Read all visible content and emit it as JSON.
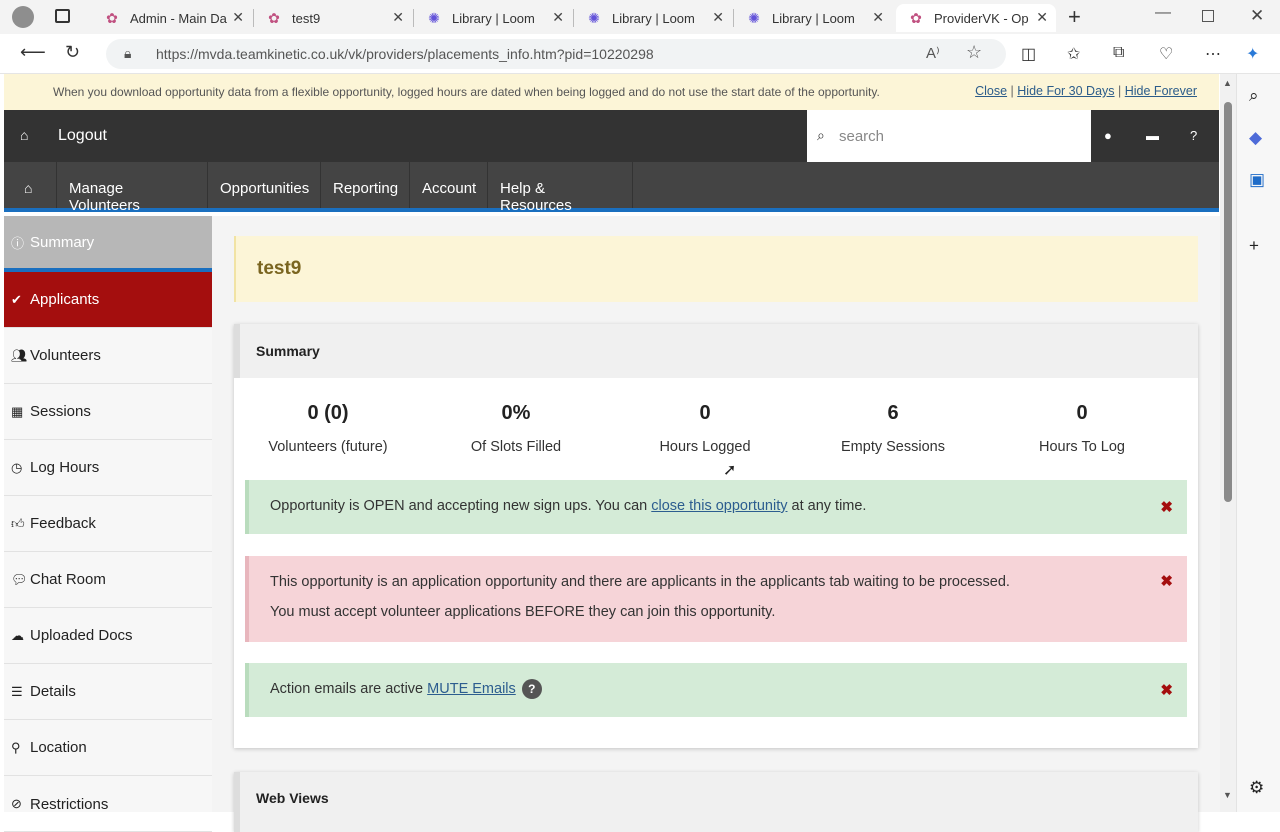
{
  "browser": {
    "tabs": [
      {
        "title": "Admin - Main Da",
        "icon": "app-icon"
      },
      {
        "title": "test9",
        "icon": "app-icon"
      },
      {
        "title": "Library | Loom",
        "icon": "loom-icon"
      },
      {
        "title": "Library | Loom",
        "icon": "loom-icon"
      },
      {
        "title": "Library | Loom",
        "icon": "loom-icon"
      },
      {
        "title": "ProviderVK - Op",
        "icon": "app-icon"
      }
    ],
    "url": "https://mvda.teamkinetic.co.uk/vk/providers/placements_info.htm?pid=10220298"
  },
  "notice": {
    "text": "When you download opportunity data from a flexible opportunity, logged hours are dated when being logged and do not use the start date of the opportunity.",
    "close": "Close",
    "hide30": "Hide For 30 Days",
    "hideforever": "Hide Forever"
  },
  "topbar": {
    "logout": "Logout",
    "search_placeholder": "search"
  },
  "nav": [
    "Manage Volunteers",
    "Opportunities",
    "Reporting",
    "Account",
    "Help & Resources"
  ],
  "sidebar": [
    {
      "label": "Summary",
      "icon": "info-icon"
    },
    {
      "label": "Applicants",
      "icon": "check-icon"
    },
    {
      "label": "Volunteers",
      "icon": "users-icon"
    },
    {
      "label": "Sessions",
      "icon": "calendar-icon"
    },
    {
      "label": "Log Hours",
      "icon": "clock-icon"
    },
    {
      "label": "Feedback",
      "icon": "thumbs-up-icon"
    },
    {
      "label": "Chat Room",
      "icon": "chat-icon"
    },
    {
      "label": "Uploaded Docs",
      "icon": "cloud-upload-icon"
    },
    {
      "label": "Details",
      "icon": "list-icon"
    },
    {
      "label": "Location",
      "icon": "map-pin-icon"
    },
    {
      "label": "Restrictions",
      "icon": "ban-icon"
    }
  ],
  "title": "test9",
  "summary": {
    "heading": "Summary",
    "stats": [
      {
        "value": "0 (0)",
        "label": "Volunteers (future)"
      },
      {
        "value": "0%",
        "label": "Of Slots Filled"
      },
      {
        "value": "0",
        "label": "Hours Logged"
      },
      {
        "value": "6",
        "label": "Empty Sessions"
      },
      {
        "value": "0",
        "label": "Hours To Log"
      }
    ],
    "alert_open": {
      "pre": "Opportunity is OPEN and accepting new sign ups. You can ",
      "link": "close this opportunity",
      "post": " at any time."
    },
    "alert_app": {
      "line1": "This opportunity is an application opportunity and there are applicants in the applicants tab waiting to be processed.",
      "line2": "You must accept volunteer applications BEFORE they can join this opportunity."
    },
    "alert_email": {
      "pre": "Action emails are active ",
      "link": "MUTE Emails",
      "help": "?"
    }
  },
  "webviews": {
    "heading": "Web Views"
  },
  "colors": {
    "accent": "#1a6fbf",
    "applicants": "#a40e0e",
    "notice_bg": "#fcf5d7"
  }
}
